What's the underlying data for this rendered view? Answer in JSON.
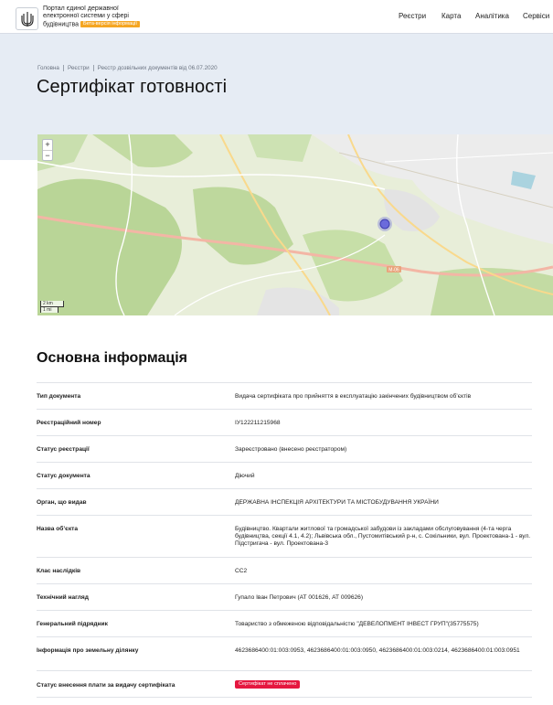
{
  "portal": {
    "name_lines": [
      "Портал єдиної державної",
      "електронної системи у сфері",
      "будівництва"
    ],
    "beta_label": "Бета-версія інформації"
  },
  "nav": {
    "items": [
      "Реєстри",
      "Карта",
      "Аналітика",
      "Сервіси"
    ]
  },
  "breadcrumb": [
    "Головна",
    "Реєстри",
    "Реєстр дозвільних документів від 06.07.2020"
  ],
  "page_title": "Сертифікат готовності",
  "map": {
    "zoom_in": "+",
    "zoom_out": "−",
    "scale_km": "2 km",
    "scale_mi": "1 mi",
    "road_label": "М-06",
    "marker_color": "#6b6bdb"
  },
  "section_title": "Основна інформація",
  "info": [
    {
      "label": "Тип документа",
      "value": "Видача сертифіката про прийняття в експлуатацію закінчених будівництвом об’єктів"
    },
    {
      "label": "Реєстраційний номер",
      "value": "ІУ122211215968"
    },
    {
      "label": "Статус реєстрації",
      "value": "Зареєстровано (внесено реєстратором)"
    },
    {
      "label": "Статус документа",
      "value": "Діючий"
    },
    {
      "label": "Орган, що видав",
      "value": "ДЕРЖАВНА ІНСПЕКЦІЯ АРХІТЕКТУРИ ТА МІСТОБУДУВАННЯ УКРАЇНИ"
    },
    {
      "label": "Назва об’єкта",
      "value": "Будівництво. Квартали житлової та громадської забудови із закладами обслуговування (4-та черга будівництва, секції 4.1, 4.2); Львівська обл., Пустомитівський р-н, с. Сокільники, вул. Проектована-1 - вул. Підстригача - вул. Проектована-3"
    },
    {
      "label": "Клас наслідків",
      "value": "СС2"
    },
    {
      "label": "Технічний нагляд",
      "value": "Гупало Іван Петрович (АТ 001626, АТ 009626)"
    },
    {
      "label": "Генеральний підрядник",
      "value": "Товариство з обмеженою відповідальністю \"ДЕВЕЛОПМЕНТ ІНВЕСТ ГРУП\"(35775575)"
    },
    {
      "label": "Інформація про земельну ділянку",
      "value": "4623686400:01:003:0953, 4623686400:01:003:0950, 4623686400:01:003:0214, 4623686400:01:003:0951"
    },
    {
      "label": "Статус внесення плати за видачу сертифіката",
      "value": "Сертифікат не сплачено"
    }
  ],
  "colors": {
    "header_bg": "#e6ecf4",
    "beta_badge": "#f5a623",
    "status_unpaid": "#e5173f"
  }
}
